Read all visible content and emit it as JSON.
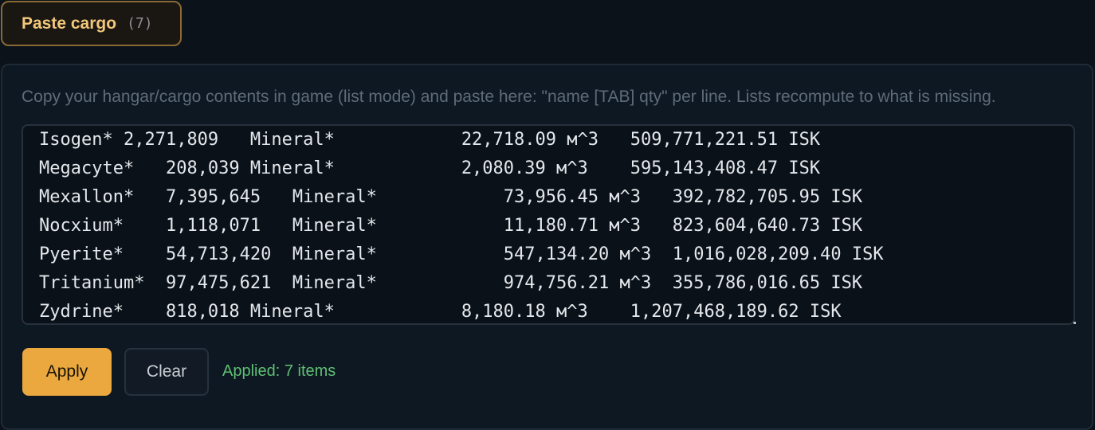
{
  "tab": {
    "label": "Paste cargo",
    "count": "(7)"
  },
  "panel": {
    "hint": "Copy your hangar/cargo contents in game (list mode) and paste here: \"name [TAB] qty\" per line. Lists recompute to what is missing.",
    "paste_text": "Isogen*\t2,271,809\tMineral*\t\t\t22,718.09 м^3\t509,771,221.51 ISK\nMegacyte*\t208,039\tMineral*\t\t\t2,080.39 м^3\t595,143,408.47 ISK\nMexallon*\t7,395,645\tMineral*\t\t\t73,956.45 м^3\t392,782,705.95 ISK\nNocxium*\t1,118,071\tMineral*\t\t\t11,180.71 м^3\t823,604,640.73 ISK\nPyerite*\t54,713,420\tMineral*\t\t\t547,134.20 м^3\t1,016,028,209.40 ISK\nTritanium*\t97,475,621\tMineral*\t\t\t974,756.21 м^3\t355,786,016.65 ISK\nZydrine*\t818,018\tMineral*\t\t\t8,180.18 м^3\t1,207,468,189.62 ISK"
  },
  "buttons": {
    "apply_label": "Apply",
    "clear_label": "Clear"
  },
  "status": {
    "text": "Applied: 7 items"
  },
  "colors": {
    "accent": "#eaa83f",
    "success": "#5fbf74",
    "background": "#0b121a"
  }
}
